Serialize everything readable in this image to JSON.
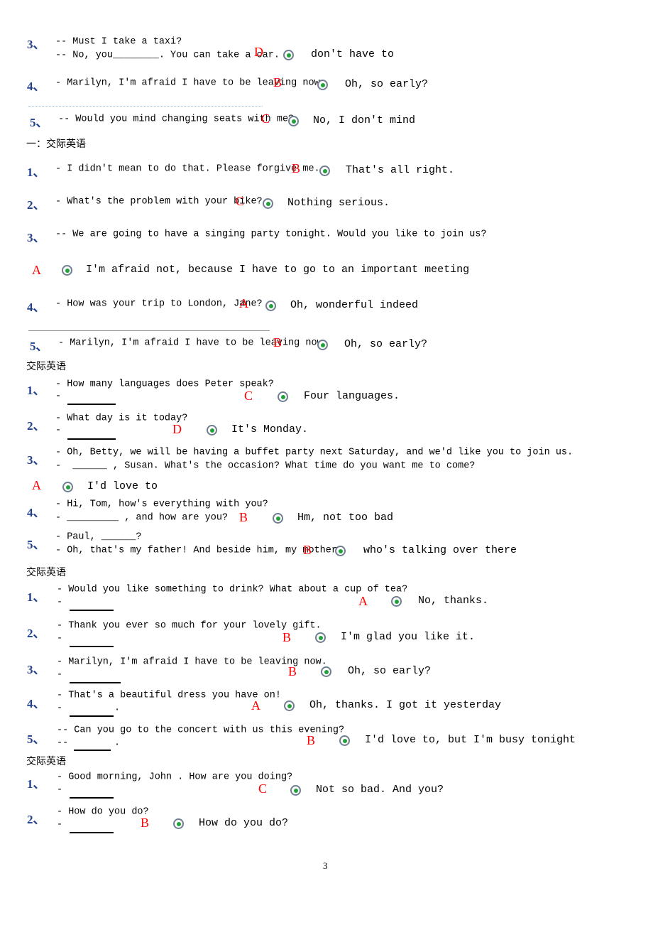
{
  "document": {
    "page_number": "3",
    "colors": {
      "question_number": "#1f3f8f",
      "answer_letter": "#ff0000",
      "radio_dot": "#22a13a",
      "dotted_separator": "#9fc0e0",
      "solid_separator": "#8f8f8f"
    }
  },
  "blocks": [
    {
      "id": "block0",
      "heading": null,
      "items": [
        {
          "number": "3、",
          "lines": [
            "-- Must I take a taxi?",
            "-- No, you________. You can take a car."
          ],
          "answer": "D",
          "option": "don't have to"
        },
        {
          "number": "4、",
          "lines": [
            "- Marilyn, I'm afraid I have to be leaving now."
          ],
          "answer": "B",
          "option": "Oh, so early?"
        },
        {
          "number": "5、",
          "lines": [
            "-- Would you mind changing seats with me?"
          ],
          "answer": "C",
          "option": "No, I don't mind"
        }
      ]
    },
    {
      "id": "block1",
      "heading": "一：交际英语",
      "items": [
        {
          "number": "1、",
          "lines": [
            "- I didn't mean to do that. Please forgive me."
          ],
          "answer": "B",
          "option": "That's all right."
        },
        {
          "number": "2、",
          "lines": [
            "- What's the problem with your bike?"
          ],
          "answer": "C",
          "option": "Nothing serious."
        },
        {
          "number": "3、",
          "lines": [
            "-- We are going to have a singing party tonight. Would you like to join us?"
          ],
          "answer": "A",
          "option": "I'm afraid not, because I have to go to an important meeting"
        },
        {
          "number": "4、",
          "lines": [
            "- How was your trip to London, Jane?"
          ],
          "answer": "A",
          "option": "Oh, wonderful indeed"
        },
        {
          "number": "5、",
          "lines": [
            "- Marilyn, I'm afraid I have to be leaving now."
          ],
          "answer": "B",
          "option": "Oh, so early?"
        }
      ]
    },
    {
      "id": "block2",
      "heading": "交际英语",
      "items": [
        {
          "number": "1、",
          "lines": [
            "- How many languages does Peter speak?",
            "-"
          ],
          "answer": "C",
          "option": "Four languages."
        },
        {
          "number": "2、",
          "lines": [
            "- What day is it today?",
            "-"
          ],
          "answer": "D",
          "option": "It's Monday."
        },
        {
          "number": "3、",
          "lines": [
            "- Oh, Betty, we will be having a buffet party next Saturday, and we'd like you to join us.",
            "-  ______ , Susan. What's the occasion? What time do you want me to come?"
          ],
          "answer": "A",
          "option": "I'd love to"
        },
        {
          "number": "4、",
          "lines": [
            "- Hi, Tom, how's everything with you?",
            "- _________ , and how are you?"
          ],
          "answer": "B",
          "option": "Hm, not too bad"
        },
        {
          "number": "5、",
          "lines": [
            "- Paul, ______?",
            "- Oh, that's my father! And beside him, my mother."
          ],
          "answer": "B",
          "option": "who's talking over there"
        }
      ]
    },
    {
      "id": "block3",
      "heading": "交际英语",
      "items": [
        {
          "number": "1、",
          "lines": [
            "- Would you like something to drink? What about a cup of tea?",
            "-"
          ],
          "answer": "A",
          "option": "No, thanks."
        },
        {
          "number": "2、",
          "lines": [
            "- Thank you ever so much for your lovely gift.",
            "-"
          ],
          "answer": "B",
          "option": "I'm glad you like it."
        },
        {
          "number": "3、",
          "lines": [
            "- Marilyn, I'm afraid I have to be leaving now.",
            "-"
          ],
          "answer": "B",
          "option": "Oh, so early?"
        },
        {
          "number": "4、",
          "lines": [
            "- That's a beautiful dress you have on!",
            "-         ."
          ],
          "answer": "A",
          "option": "Oh, thanks. I got it yesterday"
        },
        {
          "number": "5、",
          "lines": [
            "-- Can you go to the concert with us this evening?",
            "--        ."
          ],
          "answer": "B",
          "option": "I'd love to, but I'm busy tonight"
        }
      ]
    },
    {
      "id": "block4",
      "heading": "交际英语",
      "items": [
        {
          "number": "1、",
          "lines": [
            "- Good morning, John . How are you doing?",
            "-"
          ],
          "answer": "C",
          "option": "Not so bad. And you?"
        },
        {
          "number": "2、",
          "lines": [
            "- How do you do?",
            "-"
          ],
          "answer": "B",
          "option": "How do you do?"
        }
      ]
    }
  ]
}
